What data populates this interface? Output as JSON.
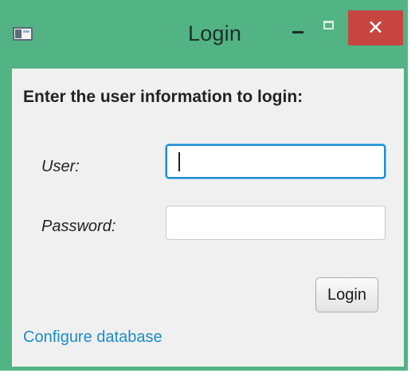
{
  "window": {
    "title": "Login",
    "icon": "app-window-icon",
    "controls": {
      "minimize": "minimize-icon",
      "maximize": "maximize-icon",
      "close": "close-icon",
      "close_glyph": "✕"
    }
  },
  "form": {
    "instruction": "Enter the user information to login:",
    "user_label": "User:",
    "user_value": "",
    "password_label": "Password:",
    "password_value": "",
    "login_button": "Login",
    "configure_link": "Configure database"
  },
  "colors": {
    "frame": "#52b384",
    "close": "#c74540",
    "focus": "#1a8ed3",
    "link": "#1b8dc6"
  }
}
